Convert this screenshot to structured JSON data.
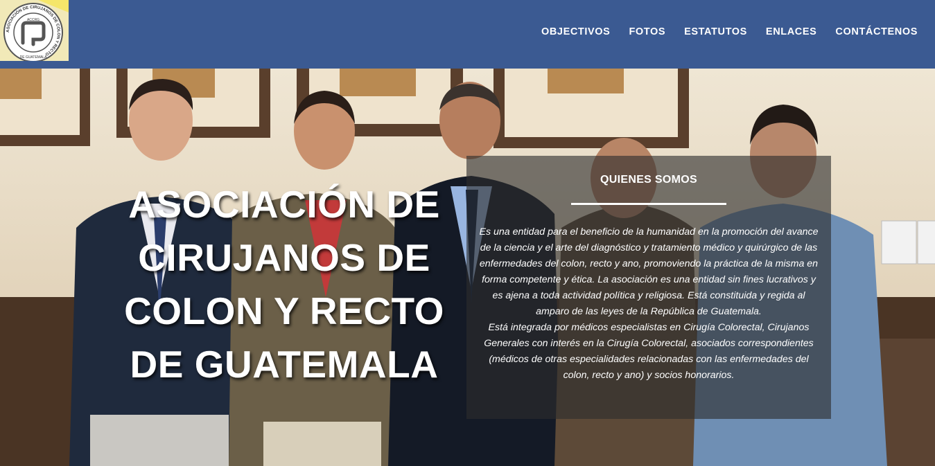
{
  "header": {
    "logo_text": {
      "ring": "ASOCIACIÓN DE CIRUJANOS DE COLON Y RECTO",
      "bottom": "DE GUATEMALA",
      "acronym": "ACCRG"
    },
    "nav": [
      {
        "label": "OBJECTIVOS"
      },
      {
        "label": "FOTOS"
      },
      {
        "label": "ESTATUTOS"
      },
      {
        "label": "ENLACES"
      },
      {
        "label": "CONTÁCTENOS"
      }
    ]
  },
  "hero": {
    "title_lines": [
      "ASOCIACIÓN DE",
      "CIRUJANOS DE",
      "COLON Y RECTO",
      "DE GUATEMALA"
    ],
    "info": {
      "title": "QUIENES SOMOS",
      "paragraph1": "Es una entidad para el beneficio de la humanidad en la promoción del avance de la ciencia y el arte del diagnóstico y tratamiento médico y quirúrgico de las enfermedades del colon, recto y ano, promoviendo la práctica de la misma en forma competente y ética. La asociación es una entidad sin fines lucrativos y es ajena a toda actividad política y religiosa. Está constituida y regida al amparo de las leyes de la República de Guatemala.",
      "paragraph2": "Está integrada por médicos especialistas en Cirugía Colorectal, Cirujanos Generales con interés en la Cirugía Colorectal, asociados correspondientes (médicos de otras especialidades relacionadas con las enfermedades del colon, recto y ano) y socios honorarios."
    }
  },
  "colors": {
    "header_bg": "#3b5a92",
    "nav_text": "#ffffff",
    "overlay_box": "rgba(45,45,45,0.62)"
  }
}
